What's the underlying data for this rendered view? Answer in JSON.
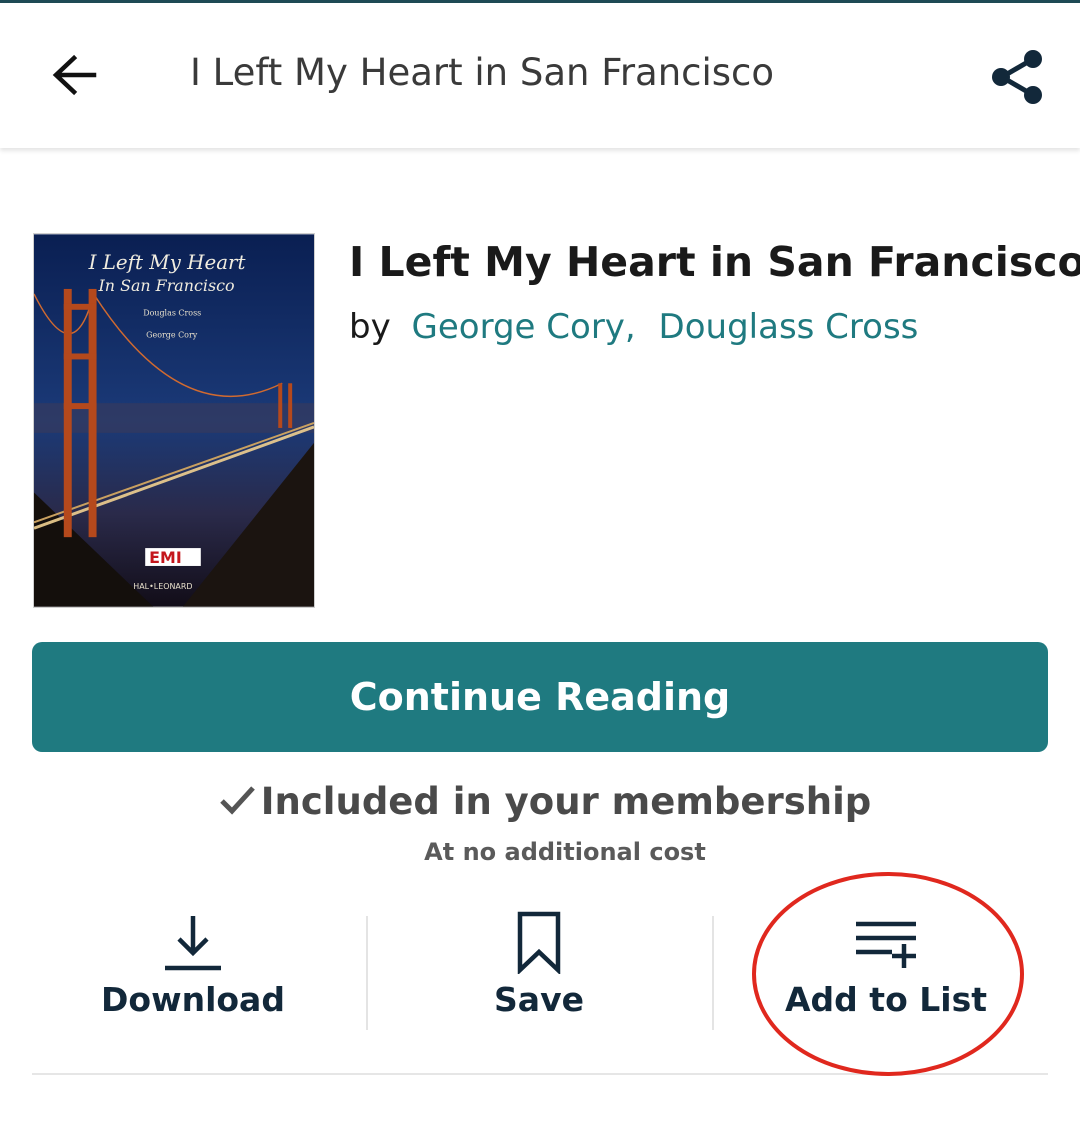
{
  "appbar": {
    "title": "I Left My Heart in San Francisco",
    "back_icon": "arrow-left-icon",
    "share_icon": "share-icon"
  },
  "book": {
    "title": "I Left My Heart in San Francisco",
    "by_label": "by",
    "authors": [
      "George Cory,",
      "Douglass Cross"
    ],
    "cover": {
      "title_line1": "I Left My Heart",
      "title_line2": "In San Francisco",
      "lyrics_by": "Douglas Cross",
      "music_by": "George Cory",
      "label": "EMI",
      "publisher": "HAL•LEONARD"
    }
  },
  "primary_action": {
    "label": "Continue Reading"
  },
  "membership": {
    "included_text": "Included in your membership",
    "cost_text": "At no additional cost",
    "check_icon": "checkmark-icon"
  },
  "actions": [
    {
      "label": "Download",
      "icon": "download-icon"
    },
    {
      "label": "Save",
      "icon": "bookmark-icon"
    },
    {
      "label": "Add to List",
      "icon": "add-to-list-icon"
    }
  ],
  "colors": {
    "accent": "#1f7a80",
    "text_dark": "#12283a",
    "annotation": "#e0281e"
  }
}
